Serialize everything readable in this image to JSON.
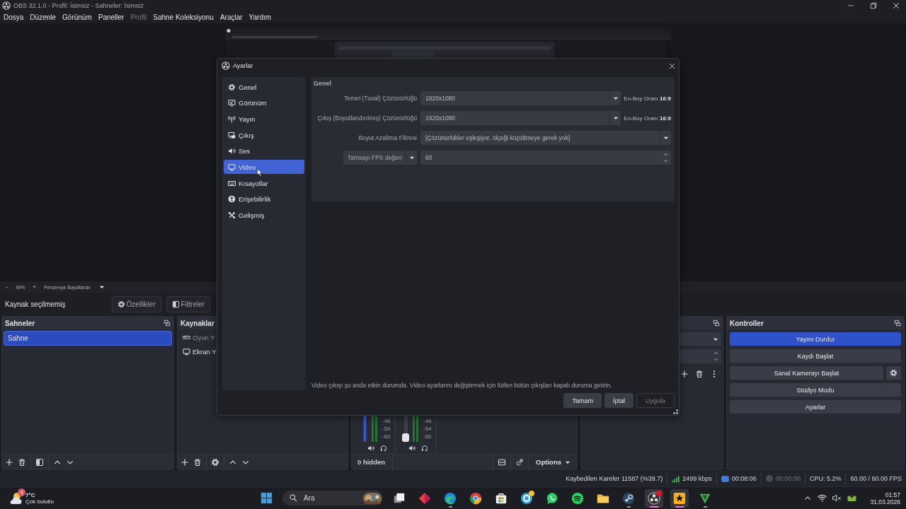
{
  "window": {
    "title": "OBS 32.1.0 - Profil: İsimsiz - Sahneler: İsimsiz"
  },
  "menu": [
    {
      "label": "Dosya",
      "disabled": false
    },
    {
      "label": "Düzenle",
      "disabled": false
    },
    {
      "label": "Görünüm",
      "disabled": false
    },
    {
      "label": "Paneller",
      "disabled": false
    },
    {
      "label": "Profil",
      "disabled": true
    },
    {
      "label": "Sahne Koleksiyonu",
      "disabled": false
    },
    {
      "label": "Araçlar",
      "disabled": false
    },
    {
      "label": "Yardım",
      "disabled": false
    }
  ],
  "preview_bar": {
    "zoom_out": "-",
    "zoom": "49%",
    "zoom_in": "+",
    "fit": "Pencereye Boyutlandır"
  },
  "context_bar": {
    "status": "Kaynak seçilmemiş",
    "buttons": [
      {
        "label": "Özellikler",
        "kind": "gear"
      },
      {
        "label": "Filtreler",
        "kind": "filter"
      }
    ]
  },
  "scenes": {
    "title": "Sahneler",
    "items": [
      {
        "label": "Sahne",
        "selected": true
      }
    ]
  },
  "sources": {
    "title": "Kaynaklar",
    "items": [
      {
        "label": "Oyun Y",
        "kind": "gamepad",
        "dimmed": true
      },
      {
        "label": "Ekran Y",
        "kind": "monitor",
        "dimmed": false
      }
    ]
  },
  "mixer": {
    "channels": [
      {
        "ticks": [
          "-48",
          "-54",
          "-60"
        ],
        "level": 1
      },
      {
        "ticks": [
          "-48",
          "-54",
          "-60"
        ],
        "level": 0
      }
    ],
    "hidden_count": "0 hidden",
    "options": "Options"
  },
  "controls": {
    "title": "Kontroller",
    "buttons": [
      {
        "label": "Yayını Durdur",
        "active": true,
        "settings": false
      },
      {
        "label": "Kaydı Başlat",
        "active": false,
        "settings": false
      },
      {
        "label": "Sanal Kamerayı Başlat",
        "active": false,
        "settings": true
      },
      {
        "label": "Stüdyo Modu",
        "active": false,
        "settings": false
      },
      {
        "label": "Ayarlar",
        "active": false,
        "settings": false
      }
    ]
  },
  "status_bar": {
    "dropped_frames": "Kaybedilen Kareler 11587 (%39.7)",
    "bitrate": "2499 kbps",
    "streaming": true,
    "stream_time": "00:08:06",
    "recording": false,
    "record_time": "00:00:00",
    "cpu": "CPU: 5.2%",
    "fps": "60.00 / 60.00 FPS"
  },
  "settings_dialog": {
    "title": "Ayarlar",
    "nav": [
      {
        "label": "Genel",
        "kind": "gear",
        "selected": false
      },
      {
        "label": "Görünüm",
        "kind": "display",
        "selected": false
      },
      {
        "label": "Yayın",
        "kind": "antenna",
        "selected": false
      },
      {
        "label": "Çıkış",
        "kind": "output",
        "selected": false
      },
      {
        "label": "Ses",
        "kind": "speaker",
        "selected": false
      },
      {
        "label": "Video",
        "kind": "monitor",
        "selected": true
      },
      {
        "label": "Kısayollar",
        "kind": "keyboard",
        "selected": false
      },
      {
        "label": "Erişebilirlik",
        "kind": "access",
        "selected": false
      },
      {
        "label": "Gelişmiş",
        "kind": "tools",
        "selected": false
      }
    ],
    "group_title": "Genel",
    "rows": [
      {
        "kind": "resolution",
        "label": "Temel (Tuval) Çözünürlüğü",
        "value": "1920x1080",
        "aspect": "En-Boy Oranı **16:9**"
      },
      {
        "kind": "resolution",
        "label": "Çıkış (Boyutlandırılmış) Çözünürlüğü",
        "value": "1920x1080",
        "aspect": "En-Boy Oranı **16:9**"
      },
      {
        "kind": "select",
        "label": "Boyut Azaltma Filtresi",
        "value": "[Çözünürlükler eşleşiyor, ölçeği küçültmeye gerek yok]"
      },
      {
        "kind": "fps",
        "label": "Tamsayı FPS değeri",
        "value": "60"
      }
    ],
    "notice": "Video çıkışı şu anda etkin durumda. Video ayarlarını değiştirmek için lütfen bütün çıkışları kapalı duruma getirin.",
    "buttons": [
      {
        "label": "Tamam",
        "disabled": false
      },
      {
        "label": "İptal",
        "disabled": false
      },
      {
        "label": "Uygula",
        "disabled": true
      }
    ]
  },
  "taskbar": {
    "weather": {
      "badge": "3",
      "temperature": "7°C",
      "condition": "Çok bulutlu"
    },
    "search": {
      "label": "Ara"
    },
    "apps": [
      {
        "kind": "taskview",
        "active": false,
        "running": false,
        "notification": false
      },
      {
        "kind": "diamond",
        "active": false,
        "running": false,
        "notification": false
      },
      {
        "kind": "edge",
        "active": false,
        "running": true,
        "notification": false
      },
      {
        "kind": "chrome",
        "active": false,
        "running": false,
        "notification": false
      },
      {
        "kind": "store",
        "active": false,
        "running": false,
        "notification": false
      },
      {
        "kind": "help",
        "active": false,
        "running": false,
        "notification": true
      },
      {
        "kind": "whatsapp",
        "active": false,
        "running": false,
        "notification": false
      },
      {
        "kind": "spotify",
        "active": false,
        "running": false,
        "notification": false
      },
      {
        "kind": "folder",
        "active": false,
        "running": false,
        "notification": false
      },
      {
        "kind": "steam",
        "active": false,
        "running": true,
        "notification": false
      },
      {
        "kind": "obs",
        "active": true,
        "running": true,
        "notification": true
      },
      {
        "kind": "rockstar",
        "active": true,
        "running": true,
        "notification": false
      },
      {
        "kind": "v",
        "active": false,
        "running": true,
        "notification": false
      }
    ],
    "time": "01:57",
    "date": "31.03.2026"
  }
}
